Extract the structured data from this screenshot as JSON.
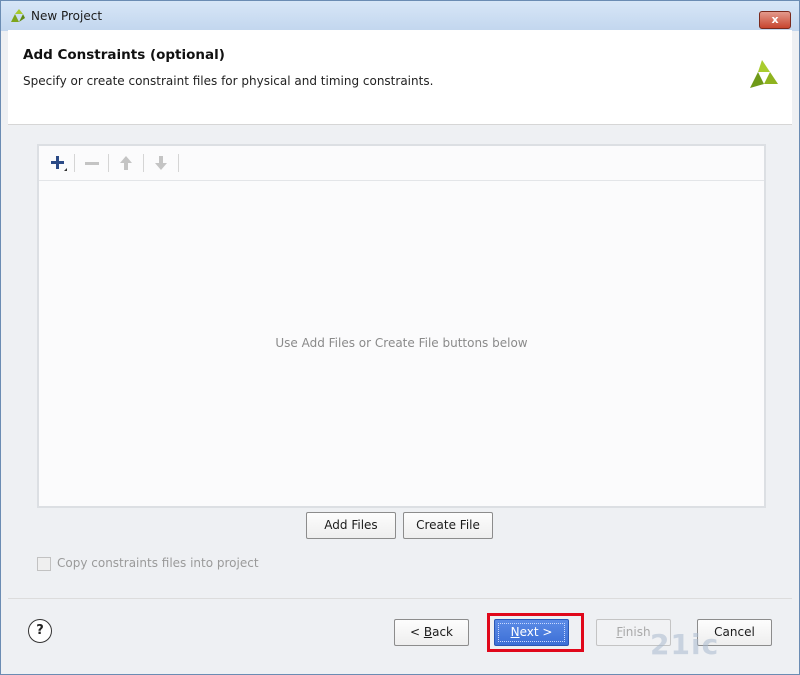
{
  "window": {
    "title": "New Project",
    "close_label": "x"
  },
  "header": {
    "title": "Add Constraints (optional)",
    "subtitle": "Specify or create constraint files for physical and timing constraints."
  },
  "toolbar": {
    "add_icon": "plus-icon",
    "remove_icon": "minus-icon",
    "up_icon": "arrow-up-icon",
    "down_icon": "arrow-down-icon"
  },
  "file_list": {
    "empty_message": "Use Add Files or Create File buttons below"
  },
  "actions": {
    "add_files": "Add Files",
    "create_file": "Create File"
  },
  "options": {
    "copy_constraints_label": "Copy constraints files into project",
    "copy_constraints_checked": false
  },
  "footer": {
    "help": "?",
    "back_prefix": "< ",
    "back_key": "B",
    "back_rest": "ack",
    "next_key": "N",
    "next_rest": "ext >",
    "finish_key": "F",
    "finish_rest": "inish",
    "cancel": "Cancel"
  },
  "watermark": "21ic",
  "colors": {
    "accent": "#3c6fd6",
    "highlight": "#e0071a",
    "logo": "#8fb31f"
  }
}
